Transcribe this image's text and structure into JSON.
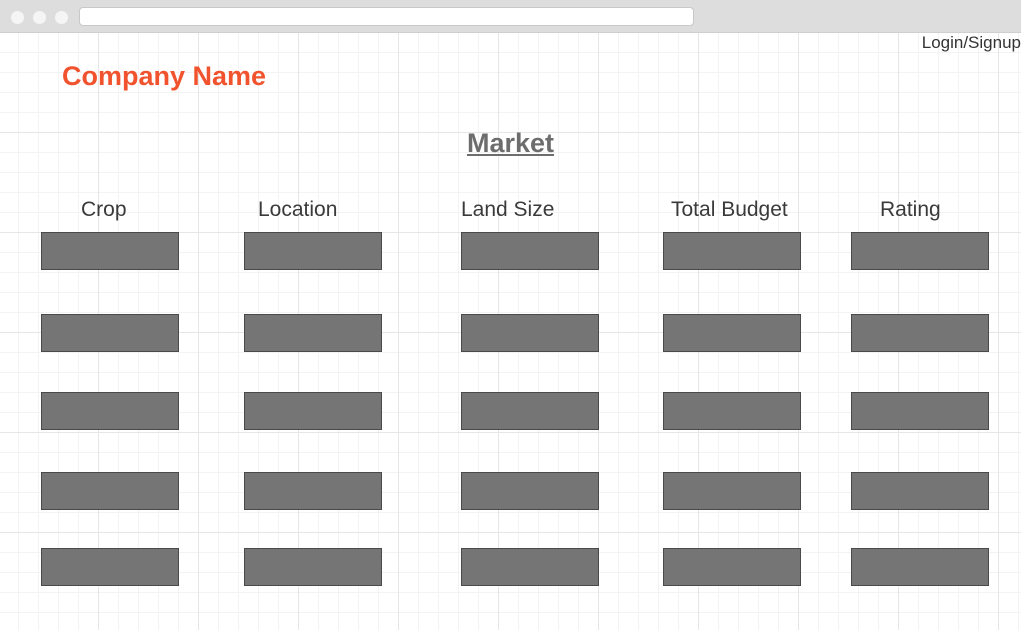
{
  "header": {
    "login_label": "Login/Signup",
    "company_name": "Company Name",
    "company_color": "#f0532d"
  },
  "page": {
    "title": "Market"
  },
  "table": {
    "columns": [
      "Crop",
      "Location",
      "Land Size",
      "Total Budget",
      "Rating"
    ],
    "row_count": 5,
    "cell_fill": "#757575"
  }
}
